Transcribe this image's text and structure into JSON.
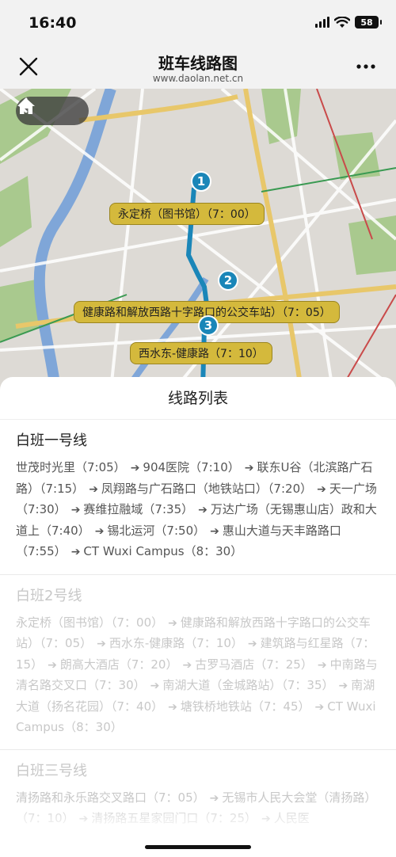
{
  "status": {
    "time": "16:40",
    "battery": "58"
  },
  "header": {
    "title": "班车线路图",
    "subtitle": "www.daolan.net.cn"
  },
  "map": {
    "stops": [
      {
        "number": "1",
        "label": "永定桥（图书馆）（7：00）"
      },
      {
        "number": "2",
        "label": "健康路和解放西路十字路口的公交车站）（7：05）"
      },
      {
        "number": "3",
        "label": "西水东-健康路（7：10）"
      }
    ],
    "route_color": "#1a86b8",
    "label_color": "#d4b93c"
  },
  "sheet": {
    "title": "线路列表",
    "routes": [
      {
        "name": "白班一号线",
        "active": true,
        "stops": [
          "世茂时光里（7:05）",
          "904医院（7:10）",
          "联东U谷（北滨路广石路）（7:15）",
          "凤翔路与广石路口（地铁站口）（7:20）",
          "天一广场（7:30）",
          "赛维拉融域（7:35）",
          "万达广场（无锡惠山店）政和大道上（7:40）",
          "锡北运河（7:50）",
          "惠山大道与天丰路路口（7:55）",
          "CT Wuxi Campus（8：30）"
        ]
      },
      {
        "name": "白班2号线",
        "active": false,
        "stops": [
          "永定桥（图书馆）（7：00）",
          "健康路和解放西路十字路口的公交车站）（7：05）",
          "西水东-健康路（7：10）",
          "建筑路与红星路（7：15）",
          "朗高大酒店（7：20）",
          "古罗马酒店（7：25）",
          "中南路与清名路交叉口（7：30）",
          "南湖大道（金城路站）（7：35）",
          "南湖大道（扬名花园）（7：40）",
          "塘铁桥地铁站（7：45）",
          "CT Wuxi Campus（8：30）"
        ]
      },
      {
        "name": "白班三号线",
        "active": false,
        "stops": [
          "清扬路和永乐路交叉路口（7：05）",
          "无锡市人民大会堂（清扬路）（7：10）",
          "清扬路五星家园门口（7：25）",
          "人民医"
        ]
      }
    ]
  }
}
